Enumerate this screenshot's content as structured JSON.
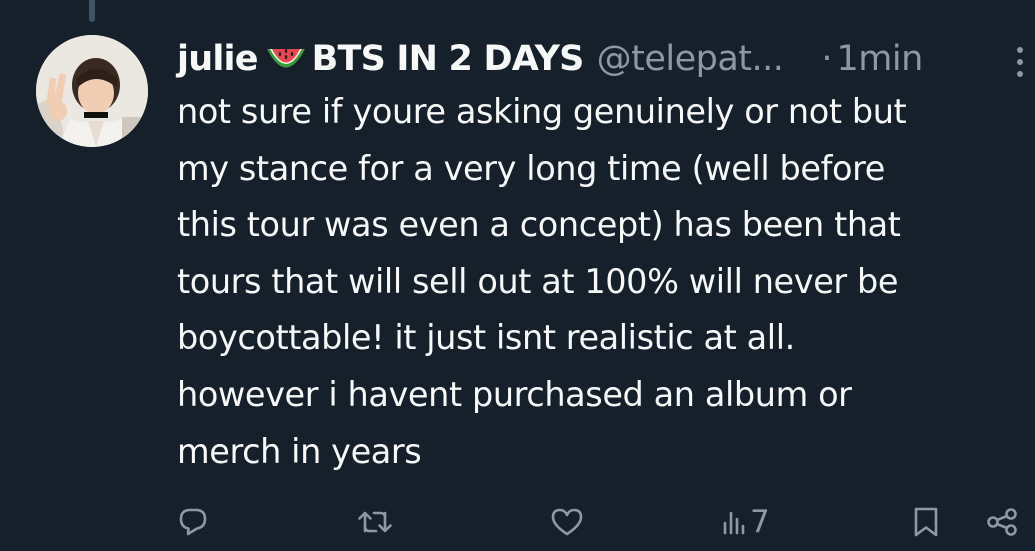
{
  "tweet": {
    "display_name": "julie",
    "emoji_icon": "watermelon-icon",
    "display_name_suffix": "BTS IN 2 DAYS",
    "handle": "@telepat...",
    "separator": "·",
    "timestamp": "1min",
    "text_lines": [
      "not sure if youre asking genuinely or not but",
      "my stance for a very long time (well before",
      "this tour was even a concept) has been that",
      "tours that will sell out at 100% will never be",
      "boycottable! it just isnt realistic at all.",
      "however i havent purchased an album or",
      "merch in years"
    ]
  },
  "actions": {
    "reply_icon": "reply-icon",
    "retweet_icon": "retweet-icon",
    "like_icon": "heart-icon",
    "views_icon": "views-icon",
    "views_count": "7",
    "bookmark_icon": "bookmark-icon",
    "share_icon": "share-icon"
  },
  "colors": {
    "background": "#15202b",
    "text_primary": "#f7f9f9",
    "text_secondary": "#8b98a5",
    "thread_line": "#425364"
  }
}
